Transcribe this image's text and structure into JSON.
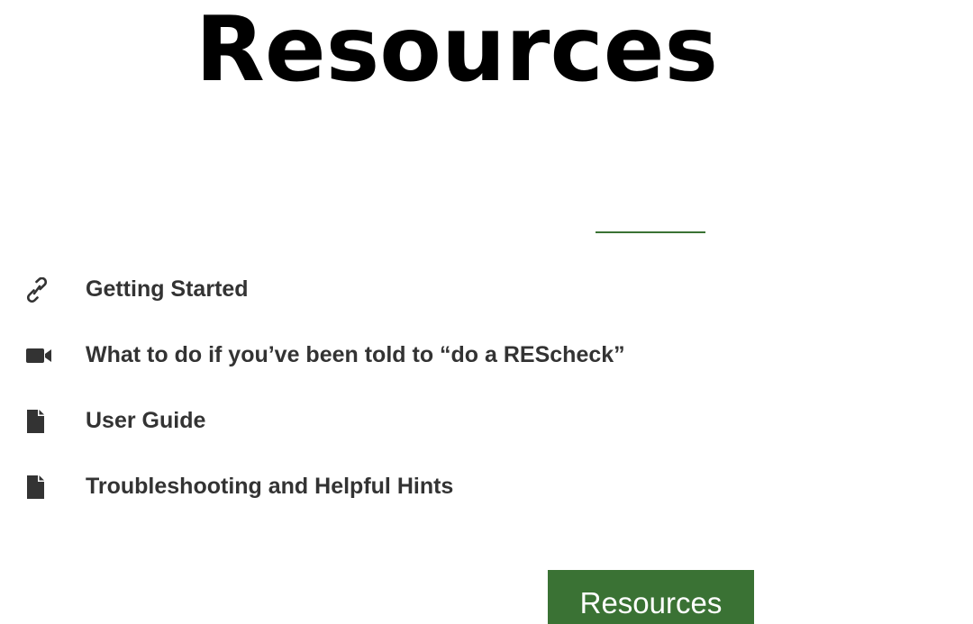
{
  "page": {
    "title": "Resources"
  },
  "accent_color": "#3a7234",
  "text_color": "#333333",
  "resources": {
    "items": [
      {
        "icon": "link-icon",
        "label": "Getting Started"
      },
      {
        "icon": "video-camera-icon",
        "label": "What to do if you’ve been told to “do a REScheck”"
      },
      {
        "icon": "document-icon",
        "label": "User Guide"
      },
      {
        "icon": "document-icon",
        "label": "Troubleshooting and Helpful Hints"
      }
    ]
  },
  "button": {
    "label": "Resources"
  }
}
